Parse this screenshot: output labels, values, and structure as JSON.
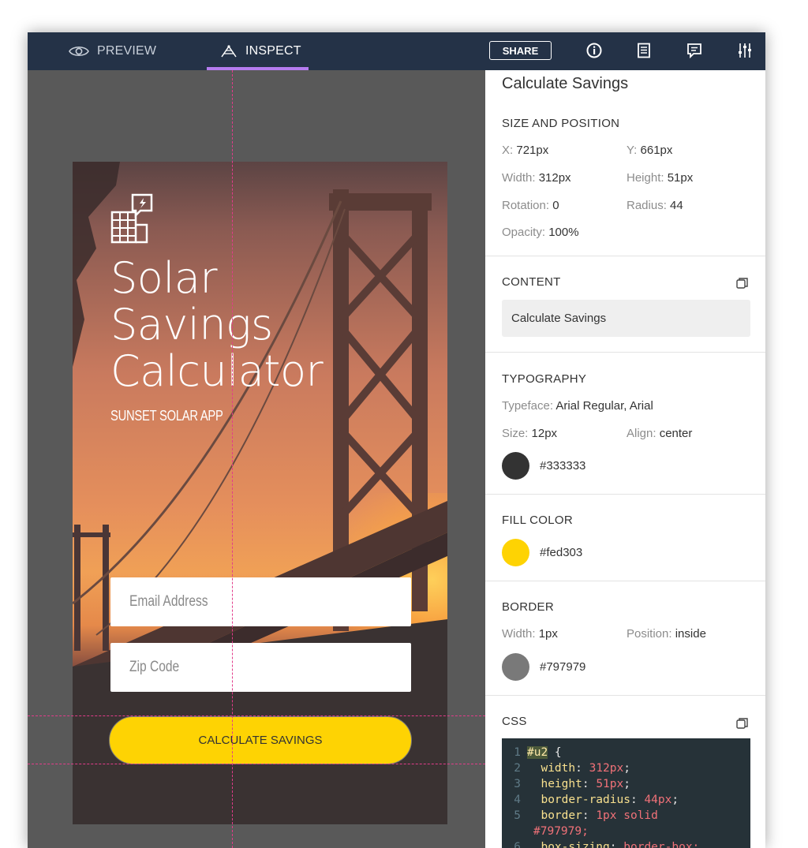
{
  "toolbar": {
    "preview_label": "PREVIEW",
    "inspect_label": "INSPECT",
    "share_label": "SHARE"
  },
  "colors": {
    "toolbar_bg": "#243247",
    "active_tab_underline": "#b57cf0",
    "guide_lines": "#e23c8a",
    "canvas_bg": "#595959"
  },
  "mockup": {
    "title_line1": "Solar",
    "title_line2": "Savings",
    "title_line3": "Calculator",
    "subtitle": "SUNSET SOLAR APP",
    "email_placeholder": "Email Address",
    "zip_placeholder": "Zip Code",
    "button_label": "CALCULATE SAVINGS"
  },
  "inspector": {
    "element_title": "Calculate Savings",
    "size_position": {
      "heading": "SIZE AND POSITION",
      "x_key": "X:",
      "x_val": "721px",
      "y_key": "Y:",
      "y_val": "661px",
      "width_key": "Width:",
      "width_val": "312px",
      "height_key": "Height:",
      "height_val": "51px",
      "rotation_key": "Rotation:",
      "rotation_val": "0",
      "radius_key": "Radius:",
      "radius_val": "44",
      "opacity_key": "Opacity:",
      "opacity_val": "100%"
    },
    "content": {
      "heading": "CONTENT",
      "value": "Calculate Savings"
    },
    "typography": {
      "heading": "TYPOGRAPHY",
      "typeface_key": "Typeface:",
      "typeface_val": "Arial Regular, Arial",
      "size_key": "Size:",
      "size_val": "12px",
      "align_key": "Align:",
      "align_val": "center",
      "color": "#333333"
    },
    "fill": {
      "heading": "FILL COLOR",
      "color": "#fed303"
    },
    "border": {
      "heading": "BORDER",
      "width_key": "Width:",
      "width_val": "1px",
      "position_key": "Position:",
      "position_val": "inside",
      "color": "#797979"
    },
    "css": {
      "heading": "CSS",
      "lines": [
        {
          "n": "1",
          "sel": "#u2",
          "rest": " {"
        },
        {
          "n": "2",
          "prop": "width",
          "val": "312px"
        },
        {
          "n": "3",
          "prop": "height",
          "val": "51px"
        },
        {
          "n": "4",
          "prop": "border-radius",
          "val": "44px"
        },
        {
          "n": "5",
          "prop": "border",
          "val": "1px solid"
        },
        {
          "n": "",
          "cont": "#797979;"
        },
        {
          "n": "6",
          "prop": "box-sizing",
          "val": "border-box;"
        }
      ]
    }
  }
}
